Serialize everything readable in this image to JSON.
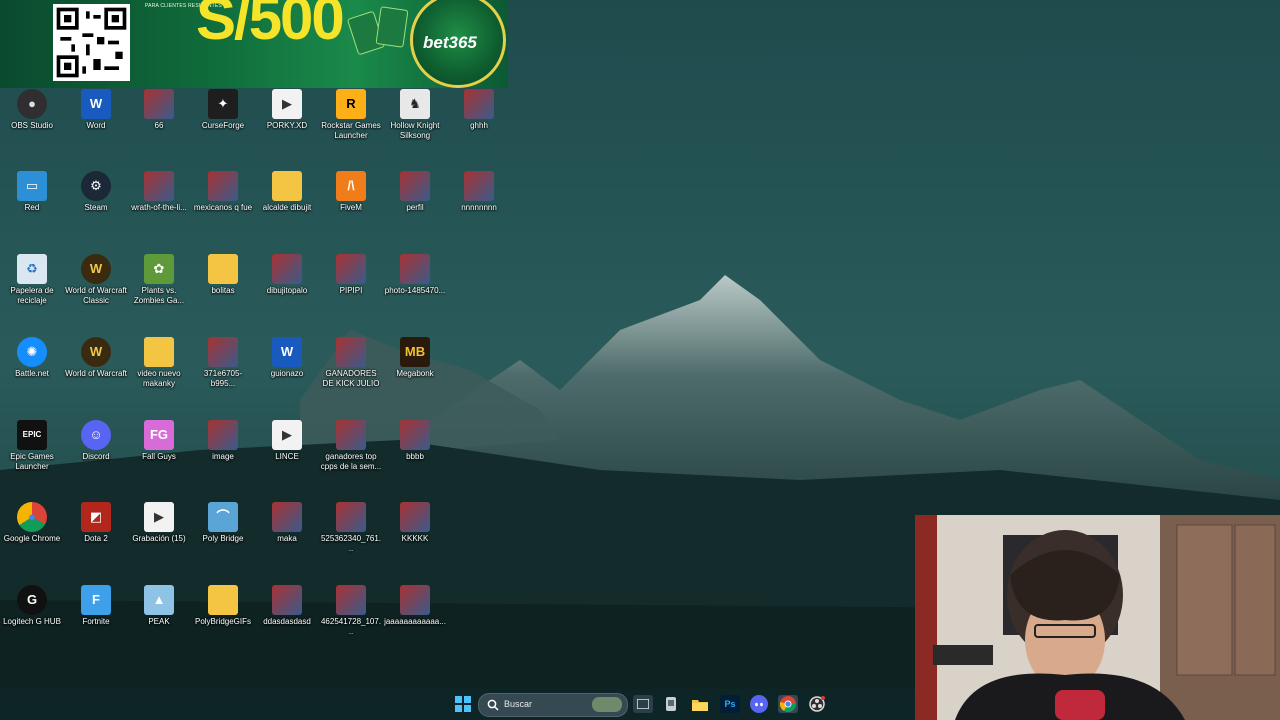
{
  "banner": {
    "small_text": "PARA CLIENTES RESIDENTES",
    "headline": "S/500",
    "brand": "bet365"
  },
  "desktop_icons": [
    {
      "label": "OBS Studio",
      "icon": "obs-icon"
    },
    {
      "label": "Word",
      "icon": "word-icon"
    },
    {
      "label": "66",
      "icon": "image-thumbnail-icon"
    },
    {
      "label": "CurseForge",
      "icon": "curseforge-icon"
    },
    {
      "label": "PORKY.XD",
      "icon": "video-file-icon"
    },
    {
      "label": "Rockstar Games Launcher",
      "icon": "rockstar-icon"
    },
    {
      "label": "Hollow Knight Silksong",
      "icon": "hollow-knight-icon"
    },
    {
      "label": "ghhh",
      "icon": "image-thumbnail-icon"
    },
    {
      "label": "Red",
      "icon": "network-icon"
    },
    {
      "label": "Steam",
      "icon": "steam-icon"
    },
    {
      "label": "wrath-of-the-li...",
      "icon": "image-thumbnail-icon"
    },
    {
      "label": "mexicanos q fue",
      "icon": "image-thumbnail-icon"
    },
    {
      "label": "alcalde dibujit",
      "icon": "folder-icon"
    },
    {
      "label": "FiveM",
      "icon": "fivem-icon"
    },
    {
      "label": "perfil",
      "icon": "image-thumbnail-icon"
    },
    {
      "label": "nnnnnnnn",
      "icon": "image-thumbnail-icon"
    },
    {
      "label": "Papelera de reciclaje",
      "icon": "recycle-bin-icon"
    },
    {
      "label": "World of Warcraft Classic",
      "icon": "wow-icon"
    },
    {
      "label": "Plants vs. Zombies Ga...",
      "icon": "pvz-icon"
    },
    {
      "label": "bolitas",
      "icon": "folder-icon"
    },
    {
      "label": "dibujitopalo",
      "icon": "image-thumbnail-icon"
    },
    {
      "label": "PIPIPI",
      "icon": "image-thumbnail-icon"
    },
    {
      "label": "photo-1485470...",
      "icon": "image-thumbnail-icon"
    },
    {
      "label": "Battle.net",
      "icon": "battlenet-icon"
    },
    {
      "label": "World of Warcraft",
      "icon": "wow-icon"
    },
    {
      "label": "video nuevo makanky",
      "icon": "folder-icon"
    },
    {
      "label": "371e6705-b995...",
      "icon": "image-thumbnail-icon"
    },
    {
      "label": "guionazo",
      "icon": "word-icon"
    },
    {
      "label": "GANADORES DE KICK JULIO",
      "icon": "image-thumbnail-icon"
    },
    {
      "label": "Megabonk",
      "icon": "megabonk-icon"
    },
    {
      "label": "Epic Games Launcher",
      "icon": "epic-games-icon"
    },
    {
      "label": "Discord",
      "icon": "discord-icon"
    },
    {
      "label": "Fall Guys",
      "icon": "fall-guys-icon"
    },
    {
      "label": "image",
      "icon": "image-thumbnail-icon"
    },
    {
      "label": "LINCE",
      "icon": "video-file-icon"
    },
    {
      "label": "ganadores top cpps de la sem...",
      "icon": "image-thumbnail-icon"
    },
    {
      "label": "bbbb",
      "icon": "image-thumbnail-icon"
    },
    {
      "label": "Google Chrome",
      "icon": "chrome-icon"
    },
    {
      "label": "Dota 2",
      "icon": "dota2-icon"
    },
    {
      "label": "Grabación (15)",
      "icon": "video-file-icon"
    },
    {
      "label": "Poly Bridge",
      "icon": "poly-bridge-icon"
    },
    {
      "label": "maka",
      "icon": "image-thumbnail-icon"
    },
    {
      "label": "525362340_761...",
      "icon": "image-thumbnail-icon"
    },
    {
      "label": "KKKKK",
      "icon": "image-thumbnail-icon"
    },
    {
      "label": "Logitech G HUB",
      "icon": "logitech-icon"
    },
    {
      "label": "Fortnite",
      "icon": "fortnite-icon"
    },
    {
      "label": "PEAK",
      "icon": "peak-icon"
    },
    {
      "label": "PolyBridgeGIFs",
      "icon": "folder-icon"
    },
    {
      "label": "ddasdasdasd",
      "icon": "image-thumbnail-icon"
    },
    {
      "label": "462541728_107...",
      "icon": "image-thumbnail-icon"
    },
    {
      "label": "jaaaaaaaaaaaa...",
      "icon": "image-thumbnail-icon"
    }
  ],
  "taskbar": {
    "search_placeholder": "Buscar",
    "apps": [
      "start-icon",
      "task-view-icon",
      "explorer-icon",
      "folder-icon",
      "photoshop-icon",
      "discord-icon",
      "chrome-icon",
      "obs-icon"
    ],
    "photoshop_label": "Ps"
  },
  "colors": {
    "accent_green": "#0f6a3a",
    "banner_yellow": "#f5e42a",
    "sky": "#1e4a4c"
  }
}
